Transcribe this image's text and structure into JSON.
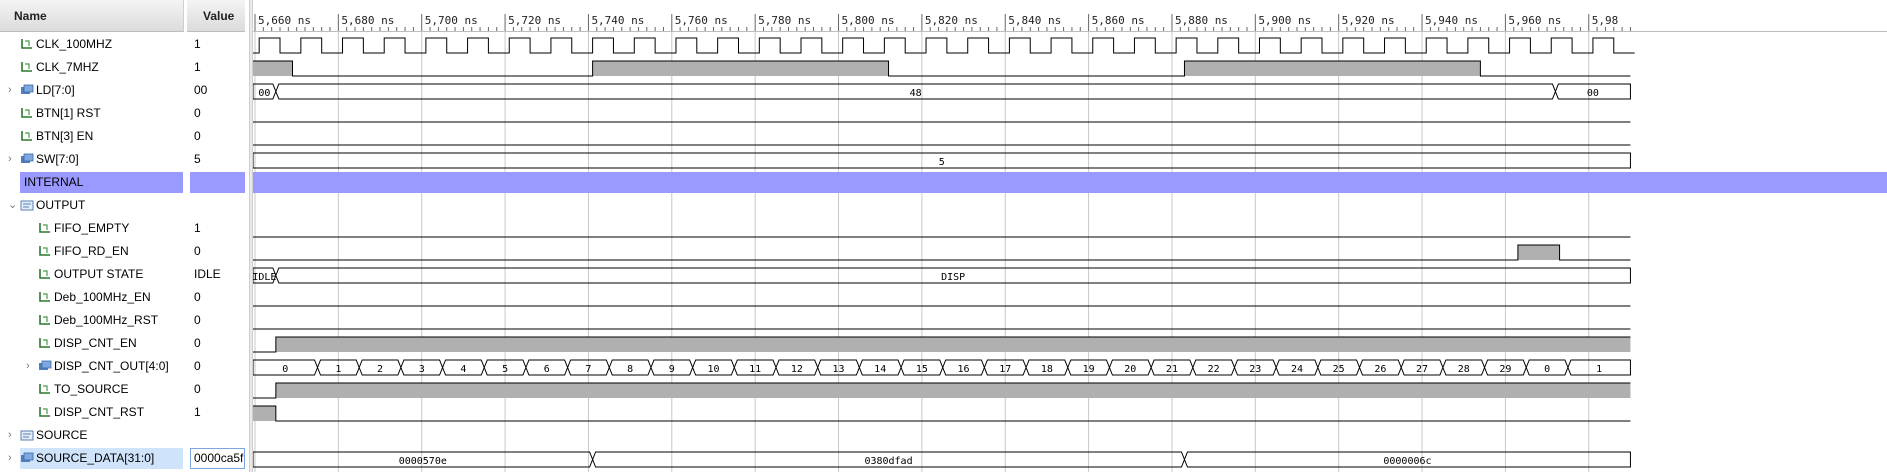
{
  "header": {
    "name": "Name",
    "value": "Value"
  },
  "time": {
    "unit": "ns",
    "axis_labels": [
      "5,660 ns",
      "5,680 ns",
      "5,700 ns",
      "5,720 ns",
      "5,740 ns",
      "5,760 ns",
      "5,780 ns",
      "5,800 ns",
      "5,820 ns",
      "5,840 ns",
      "5,860 ns",
      "5,880 ns",
      "5,900 ns",
      "5,920 ns",
      "5,940 ns",
      "5,960 ns",
      "5,98"
    ]
  },
  "colors": {
    "wave_fill": "#b0b0b0",
    "wave_line": "#000000",
    "group_band": "#9999ff",
    "grid": "#c8c8c8",
    "selected": "#cfe3fb"
  },
  "signals": [
    {
      "name": "CLK_100MHZ",
      "value": "1",
      "icon": "logic-signal-icon",
      "indent": 1,
      "expander": ""
    },
    {
      "name": "CLK_7MHZ",
      "value": "1",
      "icon": "logic-signal-icon",
      "indent": 1,
      "expander": ""
    },
    {
      "name": "LD[7:0]",
      "value": "00",
      "icon": "bus-signal-icon",
      "indent": 1,
      "expander": ">"
    },
    {
      "name": "BTN[1] RST",
      "value": "0",
      "icon": "logic-signal-icon",
      "indent": 1,
      "expander": ""
    },
    {
      "name": "BTN[3] EN",
      "value": "0",
      "icon": "logic-signal-icon",
      "indent": 1,
      "expander": ""
    },
    {
      "name": "SW[7:0]",
      "value": "5",
      "icon": "bus-signal-icon",
      "indent": 1,
      "expander": ">"
    },
    {
      "name": "INTERNAL",
      "value": "",
      "icon": "",
      "indent": 0,
      "expander": "",
      "kind": "group-band"
    },
    {
      "name": "OUTPUT",
      "value": "",
      "icon": "group-icon",
      "indent": 1,
      "expander": "v"
    },
    {
      "name": "FIFO_EMPTY",
      "value": "1",
      "icon": "logic-signal-icon",
      "indent": 2,
      "expander": ""
    },
    {
      "name": "FIFO_RD_EN",
      "value": "0",
      "icon": "logic-signal-icon",
      "indent": 2,
      "expander": ""
    },
    {
      "name": "OUTPUT STATE",
      "value": "IDLE",
      "icon": "logic-signal-icon",
      "indent": 2,
      "expander": ""
    },
    {
      "name": "Deb_100MHz_EN",
      "value": "0",
      "icon": "logic-signal-icon",
      "indent": 2,
      "expander": ""
    },
    {
      "name": "Deb_100MHz_RST",
      "value": "0",
      "icon": "logic-signal-icon",
      "indent": 2,
      "expander": ""
    },
    {
      "name": "DISP_CNT_EN",
      "value": "0",
      "icon": "logic-signal-icon",
      "indent": 2,
      "expander": ""
    },
    {
      "name": "DISP_CNT_OUT[4:0]",
      "value": "0",
      "icon": "bus-signal-icon",
      "indent": 2,
      "expander": ">"
    },
    {
      "name": "TO_SOURCE",
      "value": "0",
      "icon": "logic-signal-icon",
      "indent": 2,
      "expander": ""
    },
    {
      "name": "DISP_CNT_RST",
      "value": "1",
      "icon": "logic-signal-icon",
      "indent": 2,
      "expander": ""
    },
    {
      "name": "SOURCE",
      "value": "",
      "icon": "group-icon",
      "indent": 1,
      "expander": ">"
    },
    {
      "name": "SOURCE_DATA[31:0]",
      "value": "0000ca5f",
      "icon": "bus-signal-icon",
      "indent": 1,
      "expander": ">",
      "kind": "selected"
    }
  ],
  "waves": {
    "CLK_100MHZ": {
      "type": "clock",
      "period_ns": 10,
      "high_edges_ns": 5661,
      "duty": 0.5
    },
    "CLK_7MHZ": {
      "type": "logic",
      "segments": [
        [
          5650,
          5669,
          1
        ],
        [
          5669,
          5741,
          0
        ],
        [
          5741,
          5812,
          1
        ],
        [
          5812,
          5883,
          0
        ],
        [
          5883,
          5954,
          1
        ],
        [
          5954,
          5990,
          0
        ]
      ]
    },
    "LD[7:0]": {
      "type": "bus",
      "segments": [
        [
          5650,
          5665,
          "00"
        ],
        [
          5665,
          5972,
          "48"
        ],
        [
          5972,
          5990,
          "00"
        ]
      ]
    },
    "BTN[1] RST": {
      "type": "logic",
      "segments": [
        [
          5650,
          5990,
          0
        ]
      ]
    },
    "BTN[3] EN": {
      "type": "logic",
      "segments": [
        [
          5650,
          5990,
          0
        ]
      ]
    },
    "SW[7:0]": {
      "type": "bus",
      "segments": [
        [
          5650,
          5990,
          "5"
        ]
      ]
    },
    "INTERNAL": {
      "type": "band"
    },
    "OUTPUT": {
      "type": "none"
    },
    "FIFO_EMPTY": {
      "type": "logic",
      "segments": [
        [
          5650,
          5656,
          1
        ],
        [
          5656,
          5990,
          0
        ]
      ]
    },
    "FIFO_RD_EN": {
      "type": "logic",
      "segments": [
        [
          5650,
          5963,
          0
        ],
        [
          5963,
          5973,
          1
        ],
        [
          5973,
          5990,
          0
        ]
      ]
    },
    "OUTPUT STATE": {
      "type": "bus",
      "segments": [
        [
          5650,
          5665,
          "IDLE"
        ],
        [
          5665,
          5990,
          "DISP"
        ]
      ]
    },
    "Deb_100MHz_EN": {
      "type": "logic",
      "segments": [
        [
          5650,
          5990,
          0
        ]
      ]
    },
    "Deb_100MHz_RST": {
      "type": "logic",
      "segments": [
        [
          5650,
          5990,
          0
        ]
      ]
    },
    "DISP_CNT_EN": {
      "type": "logic",
      "segments": [
        [
          5650,
          5665,
          0
        ],
        [
          5665,
          5990,
          1
        ]
      ]
    },
    "DISP_CNT_OUT[4:0]": {
      "type": "bus",
      "segments": [
        [
          5650,
          5675,
          "0"
        ],
        [
          5675,
          5685,
          "1"
        ],
        [
          5685,
          5695,
          "2"
        ],
        [
          5695,
          5705,
          "3"
        ],
        [
          5705,
          5715,
          "4"
        ],
        [
          5715,
          5725,
          "5"
        ],
        [
          5725,
          5735,
          "6"
        ],
        [
          5735,
          5745,
          "7"
        ],
        [
          5745,
          5755,
          "8"
        ],
        [
          5755,
          5765,
          "9"
        ],
        [
          5765,
          5775,
          "10"
        ],
        [
          5775,
          5785,
          "11"
        ],
        [
          5785,
          5795,
          "12"
        ],
        [
          5795,
          5805,
          "13"
        ],
        [
          5805,
          5815,
          "14"
        ],
        [
          5815,
          5825,
          "15"
        ],
        [
          5825,
          5835,
          "16"
        ],
        [
          5835,
          5845,
          "17"
        ],
        [
          5845,
          5855,
          "18"
        ],
        [
          5855,
          5865,
          "19"
        ],
        [
          5865,
          5875,
          "20"
        ],
        [
          5875,
          5885,
          "21"
        ],
        [
          5885,
          5895,
          "22"
        ],
        [
          5895,
          5905,
          "23"
        ],
        [
          5905,
          5915,
          "24"
        ],
        [
          5915,
          5925,
          "25"
        ],
        [
          5925,
          5935,
          "26"
        ],
        [
          5935,
          5945,
          "27"
        ],
        [
          5945,
          5955,
          "28"
        ],
        [
          5955,
          5965,
          "29"
        ],
        [
          5965,
          5975,
          "0"
        ],
        [
          5975,
          5990,
          "1"
        ]
      ]
    },
    "TO_SOURCE": {
      "type": "logic",
      "segments": [
        [
          5650,
          5665,
          0
        ],
        [
          5665,
          5990,
          1
        ]
      ]
    },
    "DISP_CNT_RST": {
      "type": "logic",
      "segments": [
        [
          5650,
          5665,
          1
        ],
        [
          5665,
          5990,
          0
        ]
      ]
    },
    "SOURCE": {
      "type": "none"
    },
    "SOURCE_DATA[31:0]": {
      "type": "bus",
      "segments": [
        [
          5650,
          5741,
          "0000570e"
        ],
        [
          5741,
          5883,
          "0380dfad"
        ],
        [
          5883,
          5990,
          "0000006c"
        ]
      ]
    }
  }
}
